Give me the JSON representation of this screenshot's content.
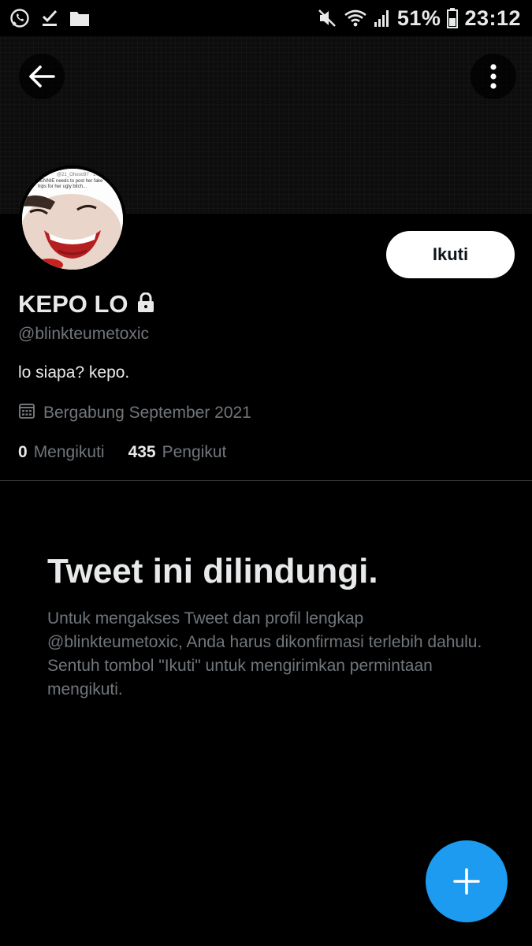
{
  "status_bar": {
    "battery_percent": "51%",
    "time": "23:12"
  },
  "profile": {
    "display_name": "KEPO LO",
    "handle": "@blinkteumetoxic",
    "bio": "lo siapa? kepo.",
    "joined": "Bergabung September 2021",
    "following_count": "0",
    "following_label": "Mengikuti",
    "followers_count": "435",
    "followers_label": "Pengikut",
    "follow_button_label": "Ikuti"
  },
  "protected_notice": {
    "title": "Tweet ini dilindungi.",
    "body": "Untuk mengakses Tweet dan profil lengkap @blinkteumetoxic, Anda harus dikonfirmasi terlebih dahulu. Sentuh tombol \"Ikuti\" untuk mengirimkan permintaan mengikuti."
  },
  "avatar_tweet_text": {
    "line1": "@21_Ohooo97 · 17",
    "line2": "JENNIE needs to post her fake",
    "line3": "hips for her ugly bitch..."
  },
  "colors": {
    "accent": "#1d9bf0",
    "background": "#000000",
    "secondary_text": "#71767b"
  },
  "icons": {
    "status_left": [
      "whatsapp-icon",
      "checkmark-download-icon",
      "folder-icon"
    ],
    "status_right": [
      "mute-icon",
      "wifi-icon",
      "signal-icon",
      "battery-icon"
    ],
    "header": [
      "back-arrow-icon",
      "more-vertical-icon"
    ],
    "lock": "lock-icon",
    "calendar": "calendar-icon",
    "fab": "plus-icon"
  }
}
